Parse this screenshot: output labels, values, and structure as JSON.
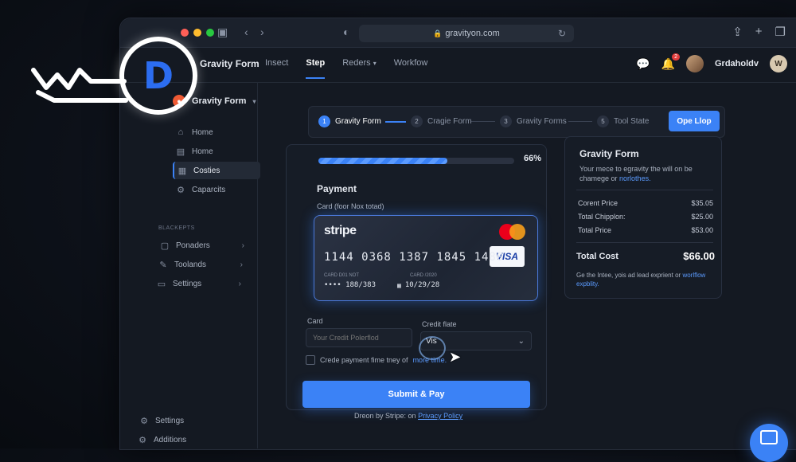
{
  "logo": {
    "letter": "D"
  },
  "browser": {
    "url": "gravityon.com"
  },
  "header": {
    "brand": "Gravity Form",
    "nav": [
      "Insect",
      "Step",
      "Reders",
      "Workfow"
    ],
    "notification_count": "2",
    "user_name": "Grdaholdv",
    "user_initial": "W"
  },
  "sidebar": {
    "title": "Gravity Form",
    "items": [
      "Home",
      "Home",
      "Costies",
      "Caparcits"
    ],
    "section_label": "BLACKEPTS",
    "section_items": [
      "Ponaders",
      "Toolands",
      "Settings"
    ],
    "bottom_items": [
      "Settings",
      "Additions"
    ]
  },
  "stepper": {
    "steps": [
      {
        "num": "1",
        "label": "Gravity Form"
      },
      {
        "num": "2",
        "label": "Cragie Form"
      },
      {
        "num": "3",
        "label": "Gravity Forms"
      },
      {
        "num": "5",
        "label": "Tool State"
      }
    ],
    "cta": "Ope Llop"
  },
  "payment": {
    "progress_label": "66%",
    "progress_value": 0.66,
    "title": "Payment",
    "card_section_label": "Card (foor Nox totad)",
    "card": {
      "brand": "stripe",
      "network": "VISA",
      "number": "1144 0368 1387 1845 1480",
      "field1_label": "CARD D01 NOT",
      "field1_value": "•••• 188/383",
      "field2_label": "CARD /2020",
      "field2_value": "10/29/28"
    },
    "card_field_label": "Card",
    "card_field_placeholder": "Your Credit Polerflod",
    "rate_field_label": "Credit flate",
    "rate_field_value": "Vis",
    "checkbox_text": "Crede payment fime tney of",
    "checkbox_link": "more time.",
    "submit_label": "Submit & Pay",
    "footer_text": "Dreon by Stripe: on",
    "footer_link": "Privacy Policy"
  },
  "summary": {
    "title": "Gravity Form",
    "desc": "Your mece to egravity the will on be chamege or",
    "desc_link": "norlothes.",
    "rows": [
      {
        "label": "Corent Price",
        "value": "$35.05"
      },
      {
        "label": "Total Chipplon:",
        "value": "$25.00"
      },
      {
        "label": "Total Price",
        "value": "$53.00"
      }
    ],
    "total_label": "Total Cost",
    "total_value": "$66.00",
    "footer": "Ge the Intee, yois ad lead exprient or",
    "footer_link": "worlflow expblity."
  },
  "colors": {
    "accent": "#3b82f6",
    "background": "#0d1119",
    "panel": "#161c26"
  },
  "icons": [
    "logo-key-icon",
    "lock-icon",
    "reload-icon",
    "share-icon",
    "plus-icon",
    "tabs-icon",
    "chat-icon",
    "bell-icon",
    "home-icon",
    "gear-icon",
    "chevron-right-icon",
    "chevron-down-icon",
    "calendar-icon",
    "cursor-icon",
    "mastercard-icon"
  ]
}
